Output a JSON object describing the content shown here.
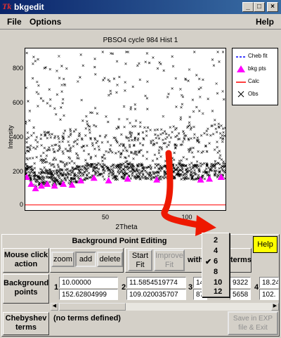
{
  "window": {
    "logo_text": "Tk",
    "title": "bkgedit",
    "min_icon": "minimize-icon",
    "max_icon": "maximize-icon",
    "close_icon": "close-icon"
  },
  "menubar": {
    "file": "File",
    "options": "Options",
    "help": "Help"
  },
  "plot": {
    "title": "PBSO4 cycle 984 Hist 1",
    "ylabel": "Intensity",
    "xlabel": "2Theta",
    "yticks": [
      "800",
      "600",
      "400",
      "200",
      "0"
    ],
    "xticks": [
      "50",
      "100"
    ]
  },
  "legend": {
    "items": [
      {
        "label": "Cheb fit",
        "color": "#0000ff",
        "style": "dashed"
      },
      {
        "label": "bkg pts",
        "color": "#ff00ff",
        "style": "triangle"
      },
      {
        "label": "Calc",
        "color": "#ff0000",
        "style": "line"
      },
      {
        "label": "Obs",
        "color": "#000000",
        "style": "cross"
      }
    ]
  },
  "chart_data": {
    "type": "scatter",
    "title": "PBSO4 cycle 984 Hist 1",
    "xlabel": "2Theta",
    "ylabel": "Intensity",
    "ylim": [
      -30,
      900
    ],
    "xlim": [
      20,
      157
    ],
    "series": [
      {
        "name": "Obs",
        "color": "#000000",
        "marker": "x"
      },
      {
        "name": "bkg pts",
        "color": "#ff00ff",
        "marker": "triangle",
        "x": [
          21,
          24,
          27,
          31,
          35,
          40,
          46,
          52,
          58,
          67,
          77,
          90,
          110,
          140,
          146,
          154
        ],
        "y": [
          160,
          120,
          95,
          110,
          120,
          110,
          120,
          115,
          140,
          155,
          140,
          150,
          145,
          145,
          150,
          160
        ]
      },
      {
        "name": "Calc",
        "color": "#ff0000",
        "x": [
          20,
          157
        ],
        "y": [
          0,
          0
        ]
      }
    ]
  },
  "panel": {
    "title": "Background Point Editing",
    "help_button": "Help",
    "mouse_click_label": "Mouse click action",
    "zoom_button": "zoom",
    "add_button": "add",
    "delete_button": "delete",
    "start_fit_button": "Start Fit",
    "improve_fit_button": "Improve Fit",
    "with_label": "with",
    "terms_label": "terms",
    "bg_points_label": "Background points",
    "points": [
      {
        "index": "1",
        "x": "10.00000",
        "y": "152.62804999"
      },
      {
        "index": "2",
        "x": "11.5854519774",
        "y": "109.020035707"
      },
      {
        "index": "3",
        "x": "14",
        "y": "87"
      },
      {
        "index": "4",
        "x": "18.24",
        "y": "102."
      }
    ],
    "point3_tail_x": "9322",
    "point3_tail_y": "5658",
    "chebyshev_label": "Chebyshev terms",
    "chebyshev_value": "(no terms defined)",
    "save_button": "Save in EXP file & Exit"
  },
  "terms_menu": {
    "options": [
      "2",
      "4",
      "6",
      "8",
      "10",
      "12"
    ],
    "selected": "6"
  }
}
